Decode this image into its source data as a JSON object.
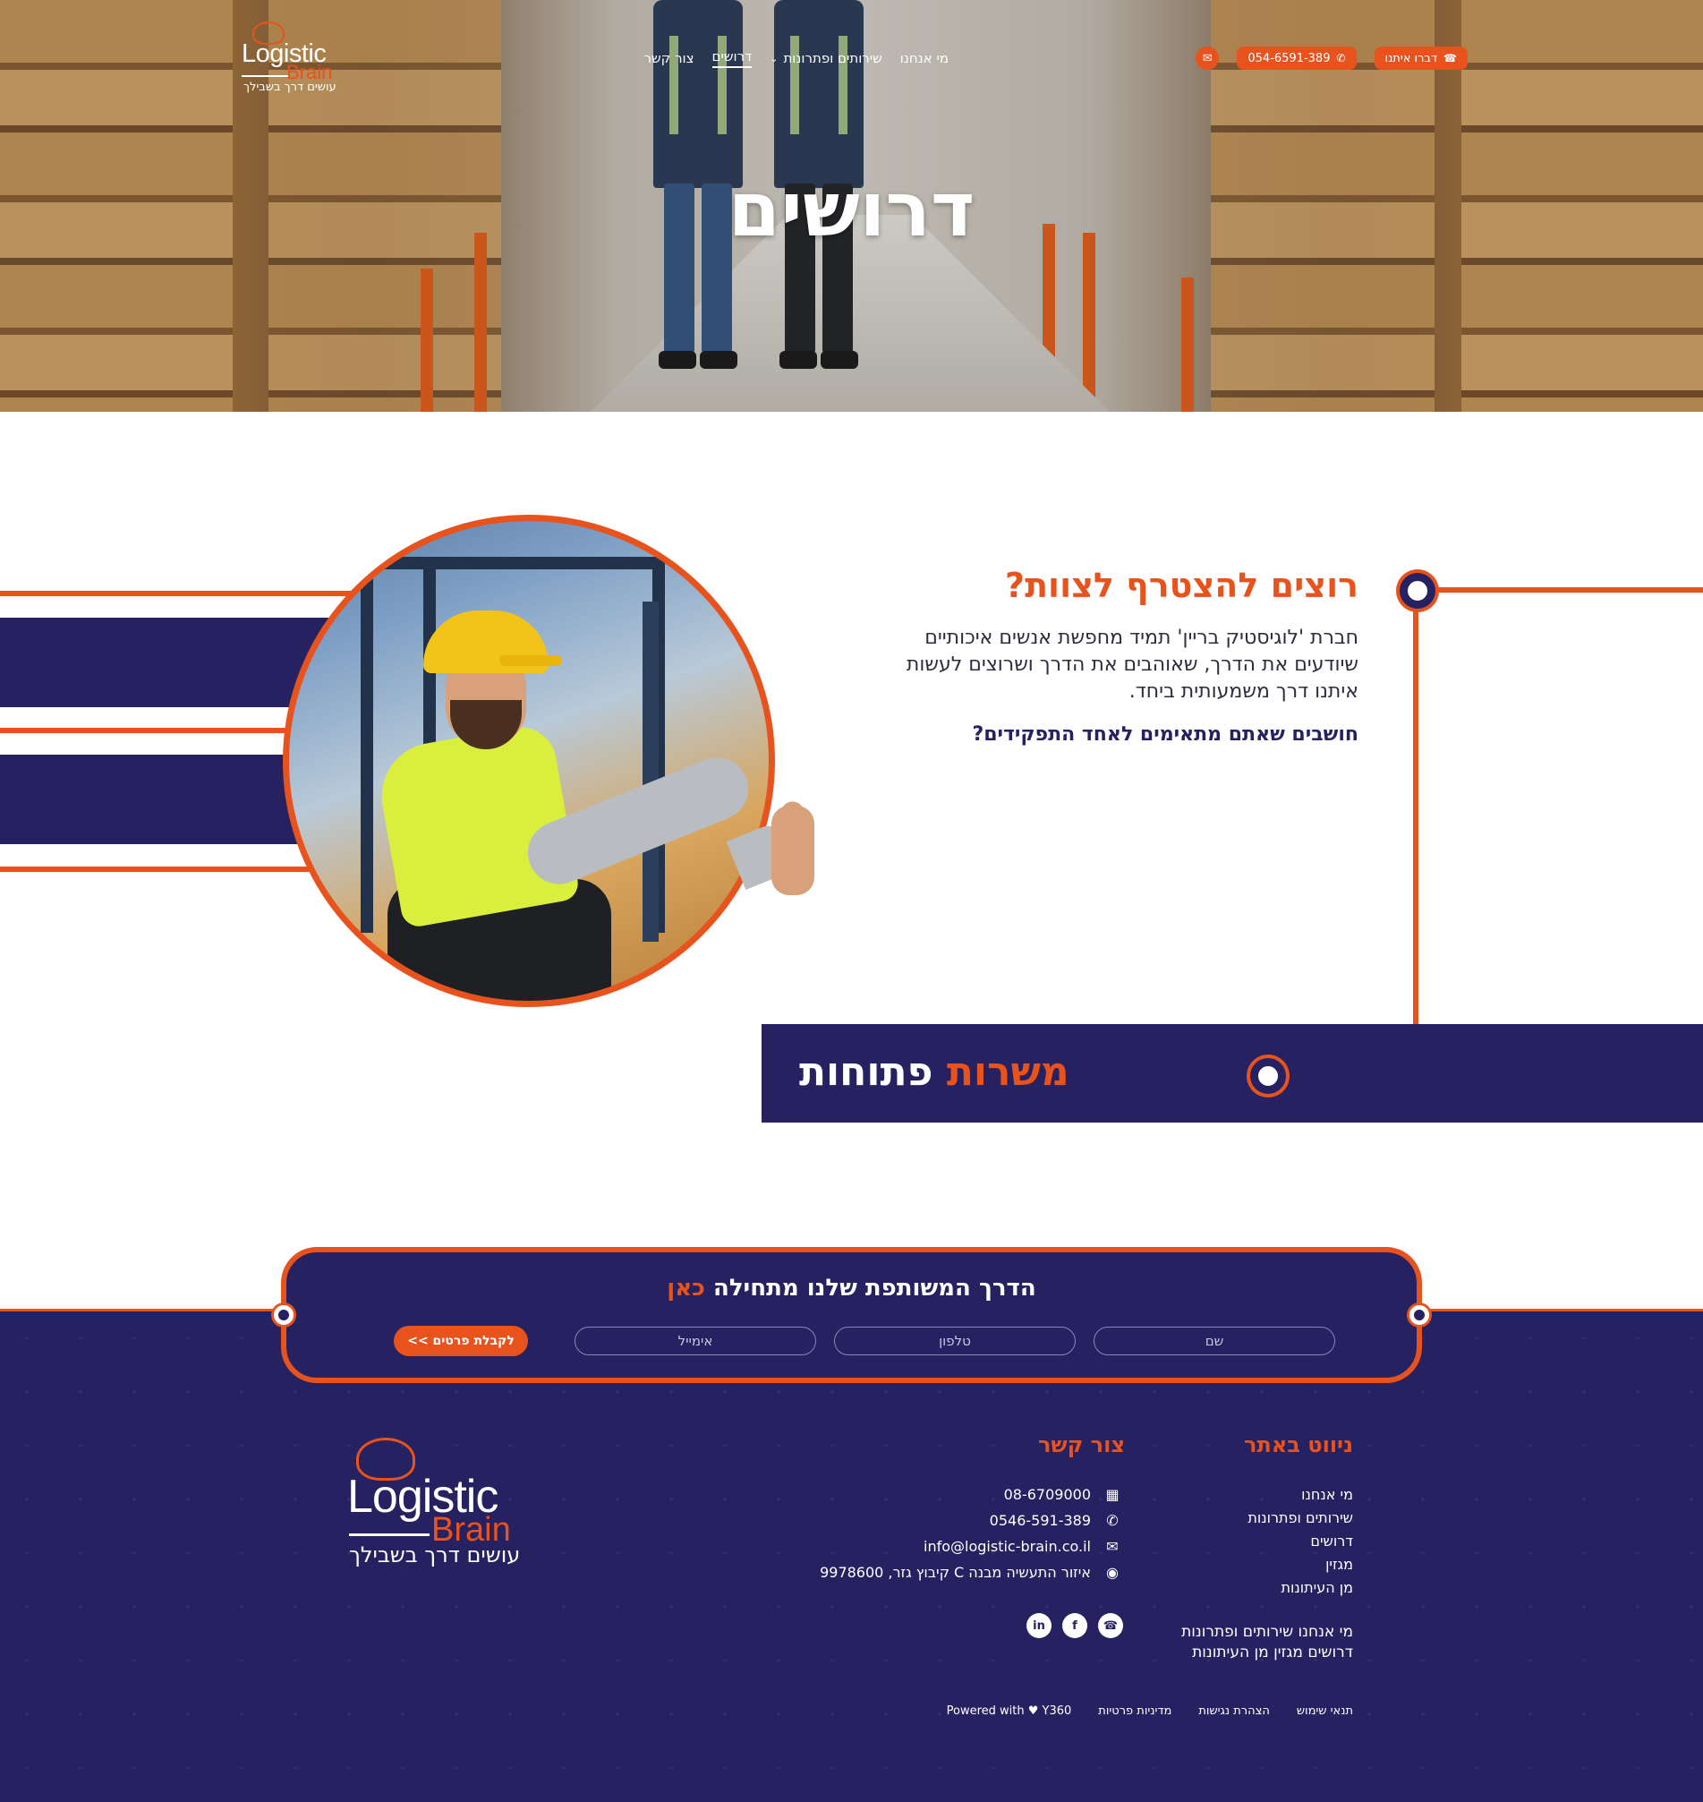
{
  "header": {
    "logo": {
      "word1": "Logistic",
      "word2": "Brain",
      "tagline": "עושים דרך בשבילך"
    },
    "nav": [
      {
        "label": "מי אנחנו"
      },
      {
        "label": "שירותים ופתרונות",
        "has_dropdown": true
      },
      {
        "label": "דרושים",
        "active": true
      },
      {
        "label": "צור קשר"
      }
    ],
    "whatsapp_label": "דברו איתנו",
    "phone_label": "054-6591-389",
    "icons": {
      "whatsapp": "whatsapp-icon",
      "phone": "phone-icon",
      "mail": "mail-icon"
    }
  },
  "hero": {
    "title": "דרושים"
  },
  "join": {
    "title": "רוצים להצטרף לצוות?",
    "text": "חברת 'לוגיסטיק בריין' תמיד מחפשת אנשים איכותיים שיודעים את הדרך, שאוהבים את הדרך ושרוצים לעשות איתנו דרך משמעותית ביחד.",
    "question": "חושבים שאתם מתאימים לאחד התפקידים?",
    "jobs_title_part1": "משרות",
    "jobs_title_part2": "פתוחות"
  },
  "form": {
    "title": "הדרך המשותפת שלנו מתחילה",
    "title_highlight": "כאן",
    "name_placeholder": "שם",
    "phone_placeholder": "טלפון",
    "email_placeholder": "אימייל",
    "submit_label": "לקבלת פרטים >>"
  },
  "footer": {
    "nav_heading": "ניווט באתר",
    "nav_items": [
      "מי אנחנו",
      "שירותים ופתרונות",
      "דרושים",
      "מגזין",
      "מן העיתונות"
    ],
    "nav_inline": "מי אנחנו  שירותים ופתרונות  דרושים  מגזין  מן העיתונות",
    "contact_heading": "צור קשר",
    "contact": {
      "office": "08-6709000",
      "mobile": "0546-591-389",
      "email": "info@logistic-brain.co.il",
      "address": "איזור התעשיה מבנה C קיבוץ גזר, 9978600"
    },
    "social": [
      "whatsapp-icon",
      "facebook-icon",
      "linkedin-icon"
    ],
    "logo": {
      "word1": "Logistic",
      "word2": "Brain",
      "tagline": "עושים דרך בשבילך"
    },
    "bottom_links": [
      "תנאי שימוש",
      "הצהרת נגישות",
      "מדיניות פרטיות",
      "Powered with ♥ Y360"
    ]
  },
  "colors": {
    "accent": "#e8531d",
    "navy": "#262160"
  }
}
